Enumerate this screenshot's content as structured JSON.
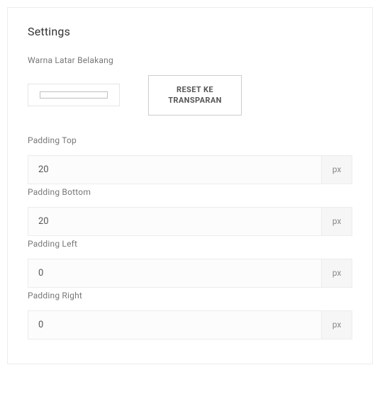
{
  "panel": {
    "title": "Settings"
  },
  "background": {
    "label": "Warna Latar Belakang",
    "reset_label": "RESET KE\nTRANSPARAN",
    "swatch_color": "#ffffff"
  },
  "padding_top": {
    "label": "Padding Top",
    "value": "20",
    "unit": "px"
  },
  "padding_bottom": {
    "label": "Padding Bottom",
    "value": "20",
    "unit": "px"
  },
  "padding_left": {
    "label": "Padding Left",
    "value": "0",
    "unit": "px"
  },
  "padding_right": {
    "label": "Padding Right",
    "value": "0",
    "unit": "px"
  }
}
